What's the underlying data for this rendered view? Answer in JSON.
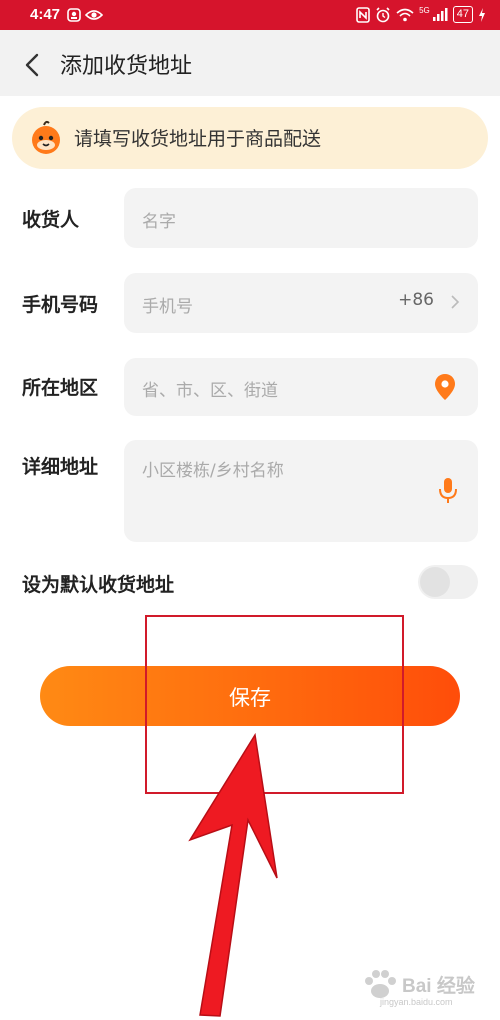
{
  "status_bar": {
    "time": "4:47",
    "signal_label": "5G",
    "battery": "47"
  },
  "header": {
    "title": "添加收货地址"
  },
  "banner": {
    "text": "请填写收货地址用于商品配送"
  },
  "form": {
    "recipient": {
      "label": "收货人",
      "placeholder": "名字"
    },
    "phone": {
      "label": "手机号码",
      "placeholder": "手机号",
      "country_code": "+86"
    },
    "region": {
      "label": "所在地区",
      "placeholder": "省、市、区、街道"
    },
    "detail": {
      "label": "详细地址",
      "placeholder": "小区楼栋/乡村名称"
    },
    "default": {
      "label": "设为默认收货地址",
      "enabled": false
    }
  },
  "save_button": {
    "label": "保存"
  },
  "watermark": {
    "brand": "Bai 经验",
    "url": "jingyan.baidu.com"
  },
  "colors": {
    "status_bar": "#d6142c",
    "accent_start": "#ff8a14",
    "accent_end": "#ff4d0a",
    "annotation": "#e0141e",
    "location_icon": "#ff7a1a",
    "banner_bg": "#fdf0d6"
  },
  "icons": [
    "back-arrow-icon",
    "location-pin-icon",
    "microphone-icon",
    "chevron-right-icon",
    "mascot-icon"
  ]
}
